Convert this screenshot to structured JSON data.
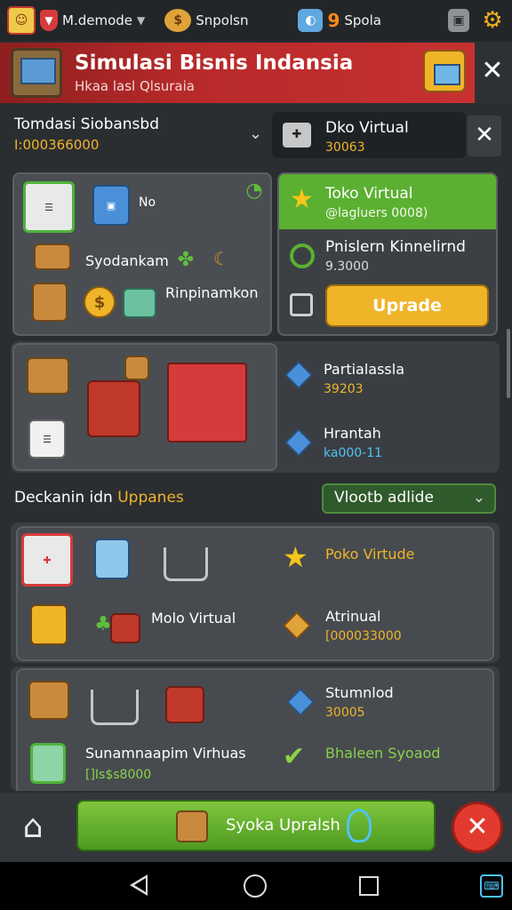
{
  "topbar": {
    "username": "M.demode",
    "currency1": "Snpolsn",
    "currency2_count": "9",
    "currency2_label": "Spola"
  },
  "banner": {
    "title": "Simulasi Bisnis Indansia",
    "subtitle": "Hkaa lasl Qlsuraia"
  },
  "section1": {
    "dropdown_title": "Tomdasi Siobansbd",
    "dropdown_value": "I:000366000",
    "virtual_card_title": "Dko Virtual",
    "virtual_card_value": "30063"
  },
  "grid1": {
    "no_label": "No",
    "item_label_1": "Syodankam",
    "item_label_2": "Rinpinamkon"
  },
  "promo": {
    "title": "Toko Virtual",
    "subtitle": "@lagluers 0008)",
    "item_title": "Pnislern Kinnelirnd",
    "item_value": "9.3000",
    "upgrade_label": "Uprade"
  },
  "panel2": {
    "item1_title": "Partialassla",
    "item1_value": "39203",
    "item2_title": "Hrantah",
    "item2_value": "ka000-11"
  },
  "section2": {
    "label_white": "Deckanin idn ",
    "label_yellow": "Uppanes",
    "select_value": "Vlootb adlide"
  },
  "panel3": {
    "star_item": "Poko Virtude",
    "center_label": "Molo Virtual",
    "item_title": "Atrinual",
    "item_value": "[000033000"
  },
  "panel4": {
    "item1_title": "Stumnlod",
    "item1_value": "30005",
    "bottom_title": "Sunamnaapim Virhuas",
    "bottom_value": "[]Is$s8000",
    "check_label": "Bhaleen Syoaod"
  },
  "actionbar": {
    "main_button": "Syoka Upralsh"
  },
  "colors": {
    "banner_red": "#b82a2a",
    "accent_yellow": "#f0b429",
    "accent_green": "#5bb032",
    "cancel_red": "#e23a2e"
  }
}
